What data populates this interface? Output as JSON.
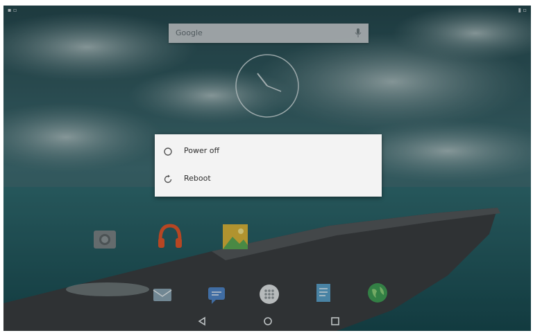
{
  "search": {
    "text": "Google"
  },
  "dialog": {
    "items": [
      {
        "label": "Power off",
        "icon": "power-icon"
      },
      {
        "label": "Reboot",
        "icon": "reboot-icon"
      }
    ]
  },
  "home_apps": [
    {
      "icon": "camera-icon"
    },
    {
      "icon": "music-icon"
    },
    {
      "icon": "gallery-icon"
    }
  ],
  "dock_apps": [
    {
      "icon": "email-icon"
    },
    {
      "icon": "messages-icon"
    },
    {
      "icon": "app-drawer-icon"
    },
    {
      "icon": "notes-icon"
    },
    {
      "icon": "browser-icon"
    }
  ],
  "navbar": {
    "buttons": [
      {
        "icon": "back-icon"
      },
      {
        "icon": "home-icon"
      },
      {
        "icon": "recents-icon"
      }
    ]
  },
  "colors": {
    "dialog_bg": "#f3f3f3",
    "sky": "#2b5960",
    "sea": "#1f4f55",
    "rock": "#3a3d40"
  }
}
